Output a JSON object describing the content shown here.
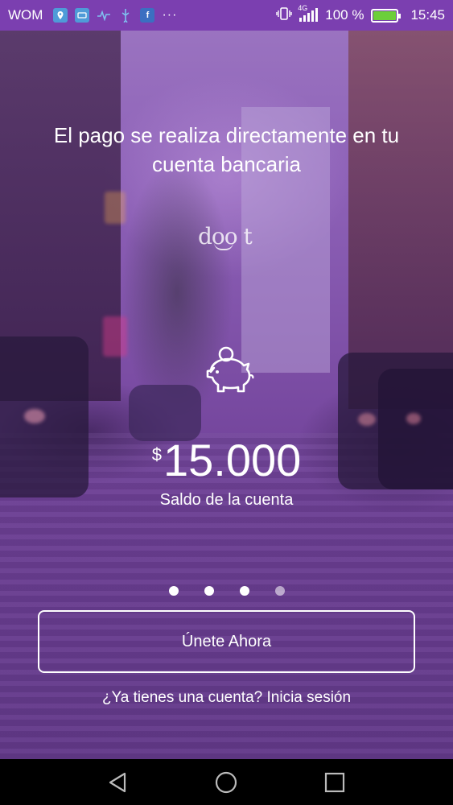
{
  "status_bar": {
    "carrier": "WOM",
    "icons": [
      "location-icon",
      "app-notification-icon",
      "activity-icon",
      "usb-icon",
      "facebook-icon"
    ],
    "more": "···",
    "network": "4G",
    "battery_text": "100 %",
    "time": "15:45"
  },
  "content": {
    "headline": "El pago se realiza directamente en tu cuenta bancaria",
    "logo_text": "doo t",
    "currency_symbol": "$",
    "balance_amount": "15.000",
    "balance_label": "Saldo de la cuenta",
    "pager": {
      "count": 4,
      "active_index": 2
    },
    "join_button_label": "Únete Ahora",
    "login_link_label": "¿Ya tienes una cuenta? Inicia sesión"
  },
  "nav_bar": {
    "buttons": [
      "back-icon",
      "home-icon",
      "recents-icon"
    ]
  },
  "colors": {
    "status_bar_bg": "#7b3fb0",
    "overlay_purple": "#7d4fa6",
    "battery_fill": "#6ccf3a",
    "text": "#ffffff"
  }
}
